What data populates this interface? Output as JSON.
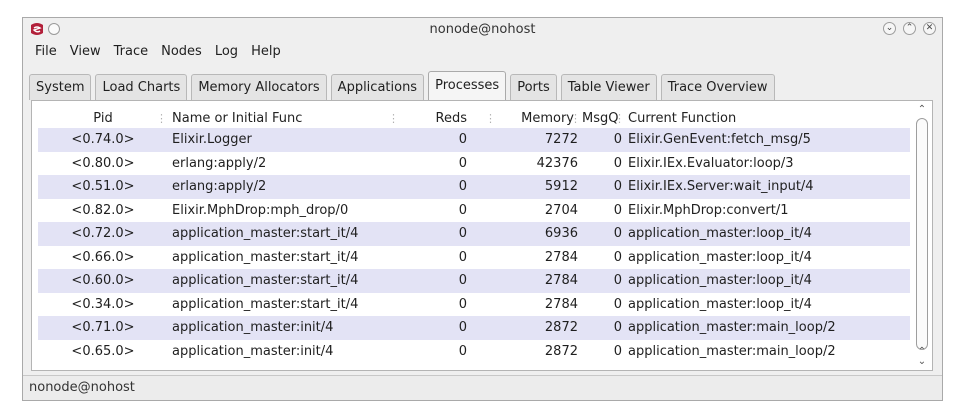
{
  "window": {
    "title": "nonode@nohost",
    "controls": [
      "minimize-icon",
      "maximize-icon",
      "close-icon"
    ]
  },
  "menu": [
    "File",
    "View",
    "Trace",
    "Nodes",
    "Log",
    "Help"
  ],
  "tabs": [
    "System",
    "Load Charts",
    "Memory Allocators",
    "Applications",
    "Processes",
    "Ports",
    "Table Viewer",
    "Trace Overview"
  ],
  "active_tab": "Processes",
  "table": {
    "columns": [
      "Pid",
      "Name or Initial Func",
      "Reds",
      "Memory",
      "MsgQ",
      "Current Function"
    ],
    "rows": [
      {
        "pid": "<0.74.0>",
        "name": "Elixir.Logger",
        "reds": "0",
        "memory": "7272",
        "msgq": "0",
        "func": "Elixir.GenEvent:fetch_msg/5"
      },
      {
        "pid": "<0.80.0>",
        "name": "erlang:apply/2",
        "reds": "0",
        "memory": "42376",
        "msgq": "0",
        "func": "Elixir.IEx.Evaluator:loop/3"
      },
      {
        "pid": "<0.51.0>",
        "name": "erlang:apply/2",
        "reds": "0",
        "memory": "5912",
        "msgq": "0",
        "func": "Elixir.IEx.Server:wait_input/4"
      },
      {
        "pid": "<0.82.0>",
        "name": "Elixir.MphDrop:mph_drop/0",
        "reds": "0",
        "memory": "2704",
        "msgq": "0",
        "func": "Elixir.MphDrop:convert/1"
      },
      {
        "pid": "<0.72.0>",
        "name": "application_master:start_it/4",
        "reds": "0",
        "memory": "6936",
        "msgq": "0",
        "func": "application_master:loop_it/4"
      },
      {
        "pid": "<0.66.0>",
        "name": "application_master:start_it/4",
        "reds": "0",
        "memory": "2784",
        "msgq": "0",
        "func": "application_master:loop_it/4"
      },
      {
        "pid": "<0.60.0>",
        "name": "application_master:start_it/4",
        "reds": "0",
        "memory": "2784",
        "msgq": "0",
        "func": "application_master:loop_it/4"
      },
      {
        "pid": "<0.34.0>",
        "name": "application_master:start_it/4",
        "reds": "0",
        "memory": "2784",
        "msgq": "0",
        "func": "application_master:loop_it/4"
      },
      {
        "pid": "<0.71.0>",
        "name": "application_master:init/4",
        "reds": "0",
        "memory": "2872",
        "msgq": "0",
        "func": "application_master:main_loop/2"
      },
      {
        "pid": "<0.65.0>",
        "name": "application_master:init/4",
        "reds": "0",
        "memory": "2872",
        "msgq": "0",
        "func": "application_master:main_loop/2"
      }
    ]
  },
  "status": "nonode@nohost",
  "colors": {
    "row_alt": "#e3e3f5",
    "app_icon": "#b2203a"
  }
}
